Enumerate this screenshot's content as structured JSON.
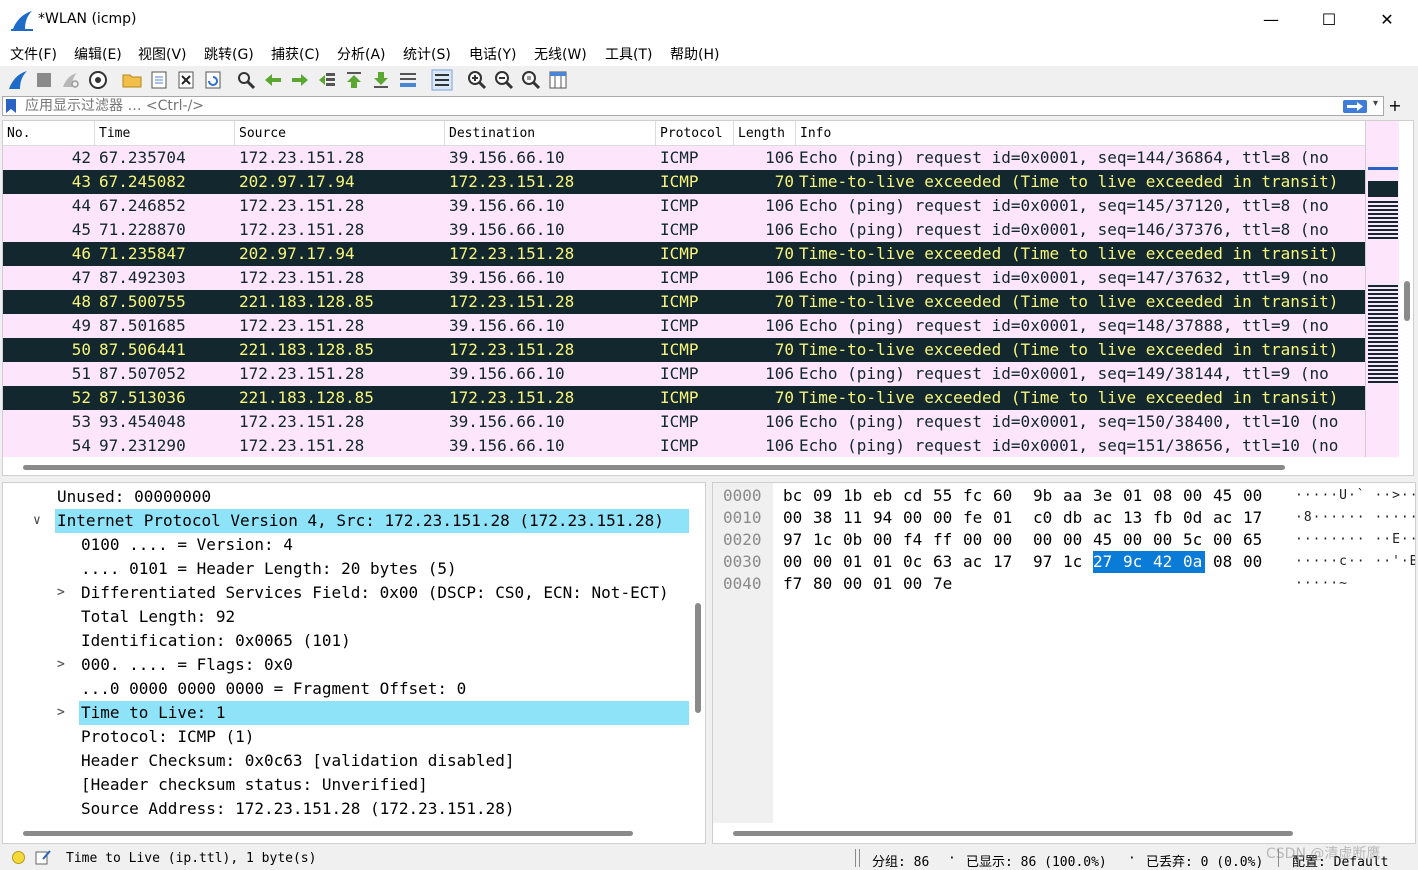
{
  "window": {
    "title": "*WLAN (icmp)",
    "minimize": "—",
    "maximize": "☐",
    "close": "✕"
  },
  "menu": [
    "文件(F)",
    "编辑(E)",
    "视图(V)",
    "跳转(G)",
    "捕获(C)",
    "分析(A)",
    "统计(S)",
    "电话(Y)",
    "无线(W)",
    "工具(T)",
    "帮助(H)"
  ],
  "filter": {
    "placeholder": "应用显示过滤器 … <Ctrl-/>",
    "value": ""
  },
  "packet_list": {
    "columns": [
      "No.",
      "Time",
      "Source",
      "Destination",
      "Protocol",
      "Length",
      "Info"
    ],
    "rows": [
      {
        "no": "42",
        "time": "67.235704",
        "src": "172.23.151.28",
        "dst": "39.156.66.10",
        "proto": "ICMP",
        "len": "106",
        "info": "Echo (ping) request  id=0x0001, seq=144/36864, ttl=8 (no",
        "kind": "req"
      },
      {
        "no": "43",
        "time": "67.245082",
        "src": "202.97.17.94",
        "dst": "172.23.151.28",
        "proto": "ICMP",
        "len": "70",
        "info": "Time-to-live exceeded (Time to live exceeded in transit)",
        "kind": "ttl"
      },
      {
        "no": "44",
        "time": "67.246852",
        "src": "172.23.151.28",
        "dst": "39.156.66.10",
        "proto": "ICMP",
        "len": "106",
        "info": "Echo (ping) request  id=0x0001, seq=145/37120, ttl=8 (no",
        "kind": "req"
      },
      {
        "no": "45",
        "time": "71.228870",
        "src": "172.23.151.28",
        "dst": "39.156.66.10",
        "proto": "ICMP",
        "len": "106",
        "info": "Echo (ping) request  id=0x0001, seq=146/37376, ttl=8 (no",
        "kind": "req"
      },
      {
        "no": "46",
        "time": "71.235847",
        "src": "202.97.17.94",
        "dst": "172.23.151.28",
        "proto": "ICMP",
        "len": "70",
        "info": "Time-to-live exceeded (Time to live exceeded in transit)",
        "kind": "ttl"
      },
      {
        "no": "47",
        "time": "87.492303",
        "src": "172.23.151.28",
        "dst": "39.156.66.10",
        "proto": "ICMP",
        "len": "106",
        "info": "Echo (ping) request  id=0x0001, seq=147/37632, ttl=9 (no",
        "kind": "req"
      },
      {
        "no": "48",
        "time": "87.500755",
        "src": "221.183.128.85",
        "dst": "172.23.151.28",
        "proto": "ICMP",
        "len": "70",
        "info": "Time-to-live exceeded (Time to live exceeded in transit)",
        "kind": "ttl"
      },
      {
        "no": "49",
        "time": "87.501685",
        "src": "172.23.151.28",
        "dst": "39.156.66.10",
        "proto": "ICMP",
        "len": "106",
        "info": "Echo (ping) request  id=0x0001, seq=148/37888, ttl=9 (no",
        "kind": "req"
      },
      {
        "no": "50",
        "time": "87.506441",
        "src": "221.183.128.85",
        "dst": "172.23.151.28",
        "proto": "ICMP",
        "len": "70",
        "info": "Time-to-live exceeded (Time to live exceeded in transit)",
        "kind": "ttl"
      },
      {
        "no": "51",
        "time": "87.507052",
        "src": "172.23.151.28",
        "dst": "39.156.66.10",
        "proto": "ICMP",
        "len": "106",
        "info": "Echo (ping) request  id=0x0001, seq=149/38144, ttl=9 (no",
        "kind": "req"
      },
      {
        "no": "52",
        "time": "87.513036",
        "src": "221.183.128.85",
        "dst": "172.23.151.28",
        "proto": "ICMP",
        "len": "70",
        "info": "Time-to-live exceeded (Time to live exceeded in transit)",
        "kind": "ttl"
      },
      {
        "no": "53",
        "time": "93.454048",
        "src": "172.23.151.28",
        "dst": "39.156.66.10",
        "proto": "ICMP",
        "len": "106",
        "info": "Echo (ping) request  id=0x0001, seq=150/38400, ttl=10 (no",
        "kind": "req"
      },
      {
        "no": "54",
        "time": "97.231290",
        "src": "172.23.151.28",
        "dst": "39.156.66.10",
        "proto": "ICMP",
        "len": "106",
        "info": "Echo (ping) request  id=0x0001, seq=151/38656, ttl=10 (no",
        "kind": "req"
      }
    ]
  },
  "details": [
    {
      "text": "Unused: 00000000",
      "indent": 0,
      "arrow": "",
      "hl": false
    },
    {
      "text": "Internet Protocol Version 4, Src: 172.23.151.28 (172.23.151.28)",
      "indent": 0,
      "arrow": "v",
      "hl": true
    },
    {
      "text": "0100 .... = Version: 4",
      "indent": 1,
      "arrow": "",
      "hl": false
    },
    {
      "text": ".... 0101 = Header Length: 20 bytes (5)",
      "indent": 1,
      "arrow": "",
      "hl": false
    },
    {
      "text": "Differentiated Services Field: 0x00 (DSCP: CS0, ECN: Not-ECT)",
      "indent": 1,
      "arrow": ">",
      "hl": false
    },
    {
      "text": "Total Length: 92",
      "indent": 1,
      "arrow": "",
      "hl": false
    },
    {
      "text": "Identification: 0x0065 (101)",
      "indent": 1,
      "arrow": "",
      "hl": false
    },
    {
      "text": "000. .... = Flags: 0x0",
      "indent": 1,
      "arrow": ">",
      "hl": false
    },
    {
      "text": "...0 0000 0000 0000 = Fragment Offset: 0",
      "indent": 1,
      "arrow": "",
      "hl": false
    },
    {
      "text": "Time to Live: 1",
      "indent": 1,
      "arrow": ">",
      "hl": true
    },
    {
      "text": "Protocol: ICMP (1)",
      "indent": 1,
      "arrow": "",
      "hl": false
    },
    {
      "text": "Header Checksum: 0x0c63 [validation disabled]",
      "indent": 1,
      "arrow": "",
      "hl": false
    },
    {
      "text": "[Header checksum status: Unverified]",
      "indent": 1,
      "arrow": "",
      "hl": false
    },
    {
      "text": "Source Address: 172.23.151.28 (172.23.151.28)",
      "indent": 1,
      "arrow": "",
      "hl": false
    }
  ],
  "bytes": [
    {
      "offset": "0000",
      "hex": [
        "bc",
        "09",
        "1b",
        "eb",
        "cd",
        "55",
        "fc",
        "60",
        "9b",
        "aa",
        "3e",
        "01",
        "08",
        "00",
        "45",
        "00"
      ],
      "ascii": "·····U·` ··>·····E·"
    },
    {
      "offset": "0010",
      "hex": [
        "00",
        "38",
        "11",
        "94",
        "00",
        "00",
        "fe",
        "01",
        "c0",
        "db",
        "ac",
        "13",
        "fb",
        "0d",
        "ac",
        "17"
      ],
      "ascii": "·8······ ········"
    },
    {
      "offset": "0020",
      "hex": [
        "97",
        "1c",
        "0b",
        "00",
        "f4",
        "ff",
        "00",
        "00",
        "00",
        "00",
        "45",
        "00",
        "00",
        "5c",
        "00",
        "65"
      ],
      "ascii": "········ ··E··\\·e"
    },
    {
      "offset": "0030",
      "hex": [
        "00",
        "00",
        "01",
        "01",
        "0c",
        "63",
        "ac",
        "17",
        "97",
        "1c",
        "27",
        "9c",
        "42",
        "0a",
        "08",
        "00"
      ],
      "ascii": "·····c·· ··'·B···"
    },
    {
      "offset": "0040",
      "hex": [
        "f7",
        "80",
        "00",
        "01",
        "00",
        "7e"
      ],
      "ascii": "·····~"
    }
  ],
  "selected_bytes": {
    "row": 3,
    "from": 10,
    "to": 13
  },
  "status": {
    "field": "Time to Live (ip.ttl), 1 byte(s)",
    "packets": "分组: 86",
    "displayed": "已显示: 86 (100.0%)",
    "dropped": "已丢弃: 0 (0.0%)",
    "profile": "配置: Default"
  },
  "watermark": "CSDN @清虚断鹰",
  "colors": {
    "request_bg": "#fde5fc",
    "ttl_bg": "#12272e",
    "ttl_fg": "#f7f57b",
    "highlight": "#8ee3f9",
    "byte_select": "#0a7bd6"
  }
}
